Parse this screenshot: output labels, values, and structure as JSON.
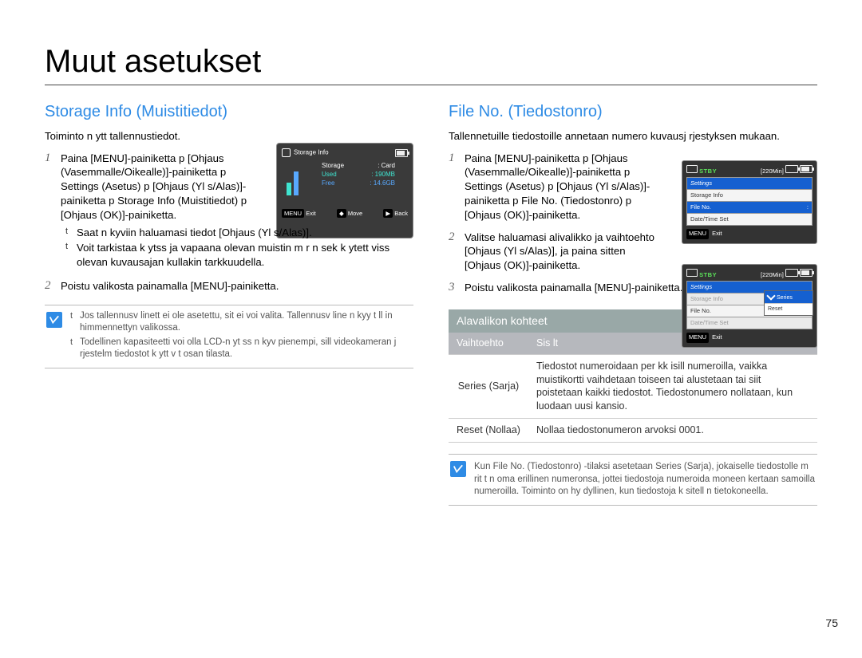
{
  "page": {
    "title": "Muut asetukset",
    "number": "75"
  },
  "left": {
    "heading": "Storage Info (Muistitiedot)",
    "intro": "Toiminto n ytt  tallennustiedot.",
    "step1": {
      "num": "1",
      "text": "Paina [MENU]-painiketta p [Ohjaus (Vasemmalle/Oikealle)]-painiketta p Settings (Asetus) p [Ohjaus (Yl s/Alas)]-painiketta p Storage Info (Muistitiedot) p [Ohjaus (OK)]-painiketta.",
      "bullets": [
        "Saat n kyviin haluamasi tiedot [Ohjaus (Yl s/Alas)].",
        "Voit tarkistaa k ytss  ja vapaana olevan muistin m r n sek  k ytett viss  olevan kuvausajan kullakin tarkkuudella."
      ]
    },
    "step2": {
      "num": "2",
      "text": "Poistu valikosta painamalla [MENU]-painiketta."
    },
    "note": [
      "Jos tallennusv linett ei ole asetettu, sit ei voi valita. Tallennusv line n kyy t ll in himmennettyn valikossa.",
      "Todellinen kapasiteetti voi olla LCD-n yt ss n kyv  pienempi, sill videokameran j rjestelm tiedostot k ytt v t osan tilasta."
    ],
    "lcd": {
      "title": "Storage Info",
      "storage_k": "Storage",
      "storage_v": ": Card",
      "used_k": "Used",
      "used_v": ": 190MB",
      "free_k": "Free",
      "free_v": ": 14.6GB",
      "exit_tag": "MENU",
      "exit": "Exit",
      "move_tag": "◆",
      "move": "Move",
      "back_tag": "▶",
      "back": "Back"
    }
  },
  "right": {
    "heading": "File No. (Tiedostonro)",
    "intro": "Tallennetuille tiedostoille annetaan numero kuvausj rjestyksen mukaan.",
    "step1": {
      "num": "1",
      "text": "Paina [MENU]-painiketta p [Ohjaus (Vasemmalle/Oikealle)]-painiketta p Settings (Asetus) p [Ohjaus (Yl s/Alas)]-painiketta p File No. (Tiedostonro) p [Ohjaus (OK)]-painiketta."
    },
    "step2": {
      "num": "2",
      "text": "Valitse haluamasi alivalikko ja vaihtoehto [Ohjaus (Yl s/Alas)], ja paina sitten [Ohjaus (OK)]-painiketta."
    },
    "step3": {
      "num": "3",
      "text": "Poistu valikosta painamalla [MENU]-painiketta."
    },
    "subhead": "Alavalikon kohteet",
    "table": {
      "col_opt": "Vaihtoehto",
      "col_desc": "Sis lt",
      "r1_opt": "Series (Sarja)",
      "r1_desc": "Tiedostot numeroidaan per kk isill numeroilla, vaikka muistikortti vaihdetaan toiseen tai alustetaan tai siit poistetaan kaikki tiedostot. Tiedostonumero nollataan, kun luodaan uusi kansio.",
      "r2_opt": "Reset (Nollaa)",
      "r2_desc": "Nollaa tiedostonumeron arvoksi 0001."
    },
    "note_single": "Kun File No. (Tiedostonro) -tilaksi asetetaan Series (Sarja), jokaiselle tiedostolle m rit t n oma erillinen numeronsa, jottei tiedostoja numeroida moneen kertaan samoilla numeroilla. Toiminto on hy dyllinen, kun tiedostoja k sitell n tietokoneella.",
    "lcd2": {
      "stby": "STBY",
      "mins": "[220Min]",
      "menu": {
        "head": "Settings",
        "i1": "Storage Info",
        "i2": "File No.",
        "i3": "Date/Time Set"
      },
      "sub_i2_val": ":",
      "exit_tag": "MENU",
      "exit": "Exit"
    },
    "lcd3": {
      "stby": "STBY",
      "mins": "[220Min]",
      "menu": {
        "head": "Settings",
        "i1": "Storage Info",
        "i2": "File No.",
        "i3": "Date/Time Set"
      },
      "sub1": "Series",
      "sub2": "Reset",
      "exit_tag": "MENU",
      "exit": "Exit"
    }
  }
}
